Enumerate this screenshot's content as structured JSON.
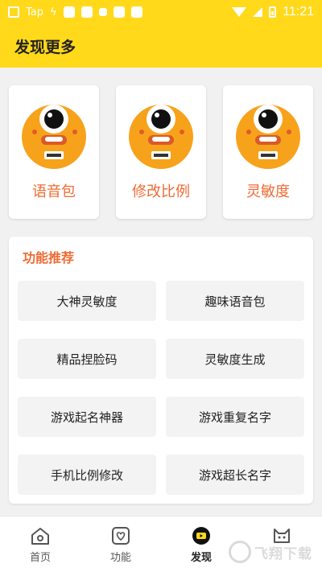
{
  "status_bar": {
    "carrier": "Tap",
    "time": "11:21"
  },
  "header": {
    "title": "发现更多"
  },
  "feature_cards": [
    {
      "label": "语音包",
      "icon": "mascot-icon"
    },
    {
      "label": "修改比例",
      "icon": "mascot-icon"
    },
    {
      "label": "灵敏度",
      "icon": "mascot-icon"
    }
  ],
  "recommend": {
    "title": "功能推荐",
    "items": [
      {
        "label": "大神灵敏度"
      },
      {
        "label": "趣味语音包"
      },
      {
        "label": "精品捏脸码"
      },
      {
        "label": "灵敏度生成"
      },
      {
        "label": "游戏起名神器"
      },
      {
        "label": "游戏重复名字"
      },
      {
        "label": "手机比例修改"
      },
      {
        "label": "游戏超长名字"
      }
    ]
  },
  "bottom_nav": [
    {
      "label": "首页",
      "icon": "home-icon"
    },
    {
      "label": "功能",
      "icon": "heart-icon"
    },
    {
      "label": "发现",
      "icon": "discover-icon",
      "active": true
    },
    {
      "label": "",
      "icon": "cat-icon"
    }
  ],
  "watermark": {
    "text": "飞翔下载"
  },
  "colors": {
    "accent_yellow": "#ffd91a",
    "accent_orange": "#ef6b33"
  }
}
